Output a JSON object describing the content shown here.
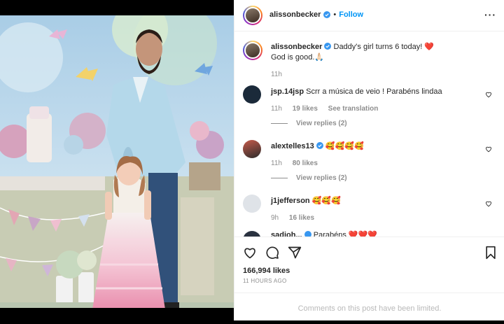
{
  "post": {
    "author": "alissonbecker",
    "follow_label": "Follow",
    "caption_line1": "Daddy's girl turns 6 today! ❤️",
    "caption_line2": "God is good.🙏🏻",
    "caption_time": "11h",
    "likes": "166,994 likes",
    "time_ago": "11 HOURS AGO",
    "comments_limited": "Comments on this post have been limited."
  },
  "comments": [
    {
      "user": "jsp.14jsp",
      "text": "Scrr a música de veio ! Parabéns lindaa",
      "time": "11h",
      "likes": "19 likes",
      "extra": "See translation",
      "replies": "View replies (2)"
    },
    {
      "user": "alextelles13",
      "text": "🥰🥰🥰🥰",
      "time": "11h",
      "likes": "80 likes",
      "replies": "View replies (2)"
    },
    {
      "user": "j1jefferson",
      "text": "🥰🥰🥰",
      "time": "9h",
      "likes": "16 likes"
    },
    {
      "user": "sadioh...",
      "text": "Parabéns ❤️❤️❤️"
    }
  ],
  "colors": {
    "accent": "#0095f6",
    "verified": "#3897f0",
    "heart": "#ed4956"
  },
  "icons": [
    "heart-icon",
    "comment-icon",
    "share-icon",
    "bookmark-icon",
    "more-icon",
    "verified-icon"
  ]
}
